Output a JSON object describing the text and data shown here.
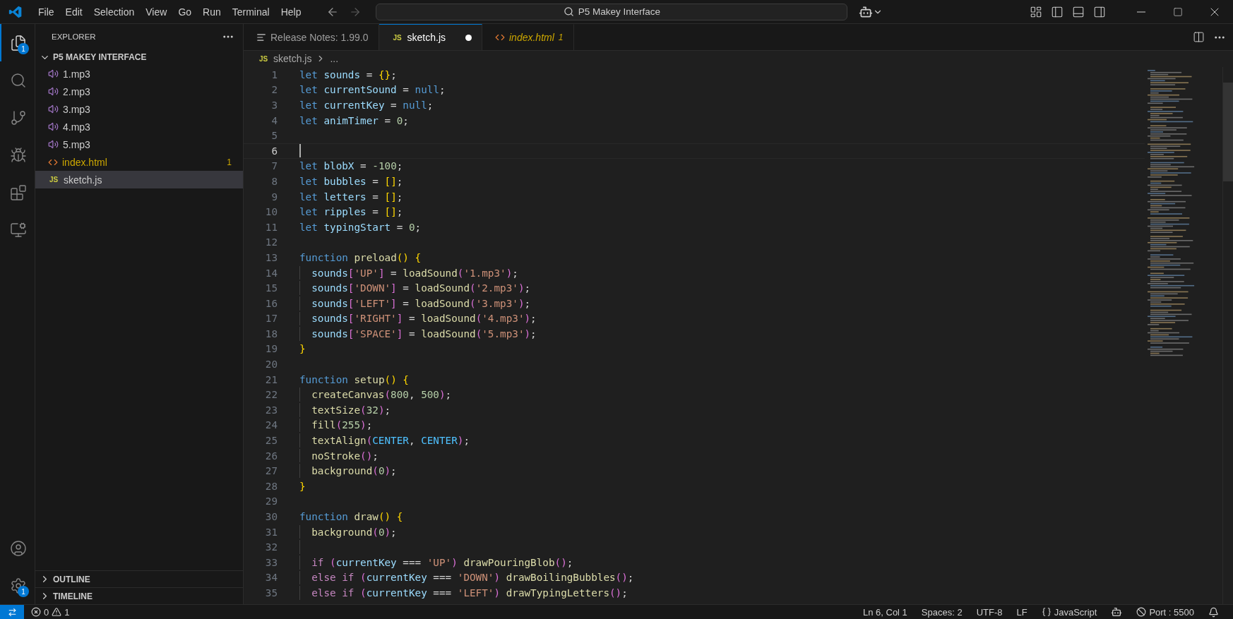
{
  "menu": [
    "File",
    "Edit",
    "Selection",
    "View",
    "Go",
    "Run",
    "Terminal",
    "Help"
  ],
  "command_center": "P5 Makey Interface",
  "activity_bar": {
    "top": [
      {
        "kind": "explorer",
        "selected": true,
        "badge": "1"
      },
      {
        "kind": "search",
        "selected": false
      },
      {
        "kind": "source-control",
        "selected": false
      },
      {
        "kind": "run-debug",
        "selected": false
      },
      {
        "kind": "extensions",
        "selected": false
      },
      {
        "kind": "remote",
        "selected": false
      }
    ],
    "bottom": [
      {
        "kind": "account",
        "selected": false
      },
      {
        "kind": "settings",
        "selected": false,
        "badge": "1"
      }
    ]
  },
  "sidebar": {
    "title": "EXPLORER",
    "folder": {
      "name": "P5 MAKEY INTERFACE",
      "expanded": true,
      "files": [
        {
          "name": "1.mp3",
          "kind": "audio",
          "selected": false
        },
        {
          "name": "2.mp3",
          "kind": "audio",
          "selected": false
        },
        {
          "name": "3.mp3",
          "kind": "audio",
          "selected": false
        },
        {
          "name": "4.mp3",
          "kind": "audio",
          "selected": false
        },
        {
          "name": "5.mp3",
          "kind": "audio",
          "selected": false
        },
        {
          "name": "index.html",
          "kind": "html",
          "selected": false,
          "problems": "1"
        },
        {
          "name": "sketch.js",
          "kind": "js",
          "icon_label": "JS",
          "selected": true
        }
      ]
    },
    "sections": [
      {
        "name": "OUTLINE",
        "expanded": false
      },
      {
        "name": "TIMELINE",
        "expanded": false
      }
    ]
  },
  "tabs": [
    {
      "label": "Release Notes: 1.99.0",
      "kind": "notes",
      "selected": false,
      "modified": false,
      "preview": false
    },
    {
      "label": "sketch.js",
      "kind": "js",
      "icon_label": "JS",
      "selected": true,
      "modified": true,
      "preview": false
    },
    {
      "label": "index.html",
      "kind": "html",
      "selected": false,
      "modified": false,
      "preview": true,
      "problems": "1"
    }
  ],
  "breadcrumb": {
    "icon_label": "JS",
    "file": "sketch.js",
    "rest": "..."
  },
  "code": [
    {
      "number": "1",
      "current": false,
      "indent": false,
      "tokens": [
        {
          "kind": "kw",
          "text": "let"
        },
        {
          "kind": "var",
          "text": " sounds"
        },
        {
          "kind": "op",
          "text": " = "
        },
        {
          "kind": "b1",
          "text": "{}"
        },
        {
          "kind": "op",
          "text": ";"
        }
      ]
    },
    {
      "number": "2",
      "current": false,
      "indent": false,
      "tokens": [
        {
          "kind": "kw",
          "text": "let"
        },
        {
          "kind": "var",
          "text": " currentSound"
        },
        {
          "kind": "op",
          "text": " = "
        },
        {
          "kind": "kw",
          "text": "null"
        },
        {
          "kind": "op",
          "text": ";"
        }
      ]
    },
    {
      "number": "3",
      "current": false,
      "indent": false,
      "tokens": [
        {
          "kind": "kw",
          "text": "let"
        },
        {
          "kind": "var",
          "text": " currentKey"
        },
        {
          "kind": "op",
          "text": " = "
        },
        {
          "kind": "kw",
          "text": "null"
        },
        {
          "kind": "op",
          "text": ";"
        }
      ]
    },
    {
      "number": "4",
      "current": false,
      "indent": false,
      "tokens": [
        {
          "kind": "kw",
          "text": "let"
        },
        {
          "kind": "var",
          "text": " animTimer"
        },
        {
          "kind": "op",
          "text": " = "
        },
        {
          "kind": "num",
          "text": "0"
        },
        {
          "kind": "op",
          "text": ";"
        }
      ]
    },
    {
      "number": "5",
      "current": false,
      "indent": false
    },
    {
      "number": "6",
      "current": true,
      "indent": false
    },
    {
      "number": "7",
      "current": false,
      "indent": false,
      "tokens": [
        {
          "kind": "kw",
          "text": "let"
        },
        {
          "kind": "var",
          "text": " blobX"
        },
        {
          "kind": "op",
          "text": " = "
        },
        {
          "kind": "num",
          "text": "-100"
        },
        {
          "kind": "op",
          "text": ";"
        }
      ]
    },
    {
      "number": "8",
      "current": false,
      "indent": false,
      "tokens": [
        {
          "kind": "kw",
          "text": "let"
        },
        {
          "kind": "var",
          "text": " bubbles"
        },
        {
          "kind": "op",
          "text": " = "
        },
        {
          "kind": "b1",
          "text": "[]"
        },
        {
          "kind": "op",
          "text": ";"
        }
      ]
    },
    {
      "number": "9",
      "current": false,
      "indent": false,
      "tokens": [
        {
          "kind": "kw",
          "text": "let"
        },
        {
          "kind": "var",
          "text": " letters"
        },
        {
          "kind": "op",
          "text": " = "
        },
        {
          "kind": "b1",
          "text": "[]"
        },
        {
          "kind": "op",
          "text": ";"
        }
      ]
    },
    {
      "number": "10",
      "current": false,
      "indent": false,
      "tokens": [
        {
          "kind": "kw",
          "text": "let"
        },
        {
          "kind": "var",
          "text": " ripples"
        },
        {
          "kind": "op",
          "text": " = "
        },
        {
          "kind": "b1",
          "text": "[]"
        },
        {
          "kind": "op",
          "text": ";"
        }
      ]
    },
    {
      "number": "11",
      "current": false,
      "indent": false,
      "tokens": [
        {
          "kind": "kw",
          "text": "let"
        },
        {
          "kind": "var",
          "text": " typingStart"
        },
        {
          "kind": "op",
          "text": " = "
        },
        {
          "kind": "num",
          "text": "0"
        },
        {
          "kind": "op",
          "text": ";"
        }
      ]
    },
    {
      "number": "12",
      "current": false,
      "indent": false
    },
    {
      "number": "13",
      "current": false,
      "indent": false,
      "tokens": [
        {
          "kind": "kw",
          "text": "function"
        },
        {
          "kind": "fn",
          "text": " preload"
        },
        {
          "kind": "b1",
          "text": "()"
        },
        {
          "kind": "b1",
          "text": " {"
        }
      ]
    },
    {
      "number": "14",
      "current": false,
      "indent": true,
      "tokens": [
        {
          "kind": "var",
          "text": "sounds"
        },
        {
          "kind": "b2",
          "text": "["
        },
        {
          "kind": "str",
          "text": "'UP'"
        },
        {
          "kind": "b2",
          "text": "]"
        },
        {
          "kind": "op",
          "text": " = "
        },
        {
          "kind": "fn",
          "text": "loadSound"
        },
        {
          "kind": "b2",
          "text": "("
        },
        {
          "kind": "str",
          "text": "'1.mp3'"
        },
        {
          "kind": "b2",
          "text": ")"
        },
        {
          "kind": "op",
          "text": ";"
        }
      ]
    },
    {
      "number": "15",
      "current": false,
      "indent": true,
      "tokens": [
        {
          "kind": "var",
          "text": "sounds"
        },
        {
          "kind": "b2",
          "text": "["
        },
        {
          "kind": "str",
          "text": "'DOWN'"
        },
        {
          "kind": "b2",
          "text": "]"
        },
        {
          "kind": "op",
          "text": " = "
        },
        {
          "kind": "fn",
          "text": "loadSound"
        },
        {
          "kind": "b2",
          "text": "("
        },
        {
          "kind": "str",
          "text": "'2.mp3'"
        },
        {
          "kind": "b2",
          "text": ")"
        },
        {
          "kind": "op",
          "text": ";"
        }
      ]
    },
    {
      "number": "16",
      "current": false,
      "indent": true,
      "tokens": [
        {
          "kind": "var",
          "text": "sounds"
        },
        {
          "kind": "b2",
          "text": "["
        },
        {
          "kind": "str",
          "text": "'LEFT'"
        },
        {
          "kind": "b2",
          "text": "]"
        },
        {
          "kind": "op",
          "text": " = "
        },
        {
          "kind": "fn",
          "text": "loadSound"
        },
        {
          "kind": "b2",
          "text": "("
        },
        {
          "kind": "str",
          "text": "'3.mp3'"
        },
        {
          "kind": "b2",
          "text": ")"
        },
        {
          "kind": "op",
          "text": ";"
        }
      ]
    },
    {
      "number": "17",
      "current": false,
      "indent": true,
      "tokens": [
        {
          "kind": "var",
          "text": "sounds"
        },
        {
          "kind": "b2",
          "text": "["
        },
        {
          "kind": "str",
          "text": "'RIGHT'"
        },
        {
          "kind": "b2",
          "text": "]"
        },
        {
          "kind": "op",
          "text": " = "
        },
        {
          "kind": "fn",
          "text": "loadSound"
        },
        {
          "kind": "b2",
          "text": "("
        },
        {
          "kind": "str",
          "text": "'4.mp3'"
        },
        {
          "kind": "b2",
          "text": ")"
        },
        {
          "kind": "op",
          "text": ";"
        }
      ]
    },
    {
      "number": "18",
      "current": false,
      "indent": true,
      "tokens": [
        {
          "kind": "var",
          "text": "sounds"
        },
        {
          "kind": "b2",
          "text": "["
        },
        {
          "kind": "str",
          "text": "'SPACE'"
        },
        {
          "kind": "b2",
          "text": "]"
        },
        {
          "kind": "op",
          "text": " = "
        },
        {
          "kind": "fn",
          "text": "loadSound"
        },
        {
          "kind": "b2",
          "text": "("
        },
        {
          "kind": "str",
          "text": "'5.mp3'"
        },
        {
          "kind": "b2",
          "text": ")"
        },
        {
          "kind": "op",
          "text": ";"
        }
      ]
    },
    {
      "number": "19",
      "current": false,
      "indent": false,
      "tokens": [
        {
          "kind": "b1",
          "text": "}"
        }
      ]
    },
    {
      "number": "20",
      "current": false,
      "indent": false
    },
    {
      "number": "21",
      "current": false,
      "indent": false,
      "tokens": [
        {
          "kind": "kw",
          "text": "function"
        },
        {
          "kind": "fn",
          "text": " setup"
        },
        {
          "kind": "b1",
          "text": "()"
        },
        {
          "kind": "b1",
          "text": " {"
        }
      ]
    },
    {
      "number": "22",
      "current": false,
      "indent": true,
      "tokens": [
        {
          "kind": "fn",
          "text": "createCanvas"
        },
        {
          "kind": "b2",
          "text": "("
        },
        {
          "kind": "num",
          "text": "800"
        },
        {
          "kind": "op",
          "text": ","
        },
        {
          "kind": "num",
          "text": " 500"
        },
        {
          "kind": "b2",
          "text": ")"
        },
        {
          "kind": "op",
          "text": ";"
        }
      ]
    },
    {
      "number": "23",
      "current": false,
      "indent": true,
      "tokens": [
        {
          "kind": "fn",
          "text": "textSize"
        },
        {
          "kind": "b2",
          "text": "("
        },
        {
          "kind": "num",
          "text": "32"
        },
        {
          "kind": "b2",
          "text": ")"
        },
        {
          "kind": "op",
          "text": ";"
        }
      ]
    },
    {
      "number": "24",
      "current": false,
      "indent": true,
      "tokens": [
        {
          "kind": "fn",
          "text": "fill"
        },
        {
          "kind": "b2",
          "text": "("
        },
        {
          "kind": "num",
          "text": "255"
        },
        {
          "kind": "b2",
          "text": ")"
        },
        {
          "kind": "op",
          "text": ";"
        }
      ]
    },
    {
      "number": "25",
      "current": false,
      "indent": true,
      "tokens": [
        {
          "kind": "fn",
          "text": "textAlign"
        },
        {
          "kind": "b2",
          "text": "("
        },
        {
          "kind": "const",
          "text": "CENTER"
        },
        {
          "kind": "op",
          "text": ","
        },
        {
          "kind": "const",
          "text": " CENTER"
        },
        {
          "kind": "b2",
          "text": ")"
        },
        {
          "kind": "op",
          "text": ";"
        }
      ]
    },
    {
      "number": "26",
      "current": false,
      "indent": true,
      "tokens": [
        {
          "kind": "fn",
          "text": "noStroke"
        },
        {
          "kind": "b2",
          "text": "()"
        },
        {
          "kind": "op",
          "text": ";"
        }
      ]
    },
    {
      "number": "27",
      "current": false,
      "indent": true,
      "tokens": [
        {
          "kind": "fn",
          "text": "background"
        },
        {
          "kind": "b2",
          "text": "("
        },
        {
          "kind": "num",
          "text": "0"
        },
        {
          "kind": "b2",
          "text": ")"
        },
        {
          "kind": "op",
          "text": ";"
        }
      ]
    },
    {
      "number": "28",
      "current": false,
      "indent": false,
      "tokens": [
        {
          "kind": "b1",
          "text": "}"
        }
      ]
    },
    {
      "number": "29",
      "current": false,
      "indent": false
    },
    {
      "number": "30",
      "current": false,
      "indent": false,
      "tokens": [
        {
          "kind": "kw",
          "text": "function"
        },
        {
          "kind": "fn",
          "text": " draw"
        },
        {
          "kind": "b1",
          "text": "()"
        },
        {
          "kind": "b1",
          "text": " {"
        }
      ]
    },
    {
      "number": "31",
      "current": false,
      "indent": true,
      "tokens": [
        {
          "kind": "fn",
          "text": "background"
        },
        {
          "kind": "b2",
          "text": "("
        },
        {
          "kind": "num",
          "text": "0"
        },
        {
          "kind": "b2",
          "text": ")"
        },
        {
          "kind": "op",
          "text": ";"
        }
      ]
    },
    {
      "number": "32",
      "current": false,
      "indent": true
    },
    {
      "number": "33",
      "current": false,
      "indent": true,
      "tokens": [
        {
          "kind": "ctl",
          "text": "if"
        },
        {
          "kind": "b2",
          "text": " ("
        },
        {
          "kind": "var",
          "text": "currentKey"
        },
        {
          "kind": "op",
          "text": " === "
        },
        {
          "kind": "str",
          "text": "'UP'"
        },
        {
          "kind": "b2",
          "text": ")"
        },
        {
          "kind": "fn",
          "text": " drawPouringBlob"
        },
        {
          "kind": "b2",
          "text": "()"
        },
        {
          "kind": "op",
          "text": ";"
        }
      ]
    },
    {
      "number": "34",
      "current": false,
      "indent": true,
      "tokens": [
        {
          "kind": "ctl",
          "text": "else"
        },
        {
          "kind": "ctl",
          "text": " if"
        },
        {
          "kind": "b2",
          "text": " ("
        },
        {
          "kind": "var",
          "text": "currentKey"
        },
        {
          "kind": "op",
          "text": " === "
        },
        {
          "kind": "str",
          "text": "'DOWN'"
        },
        {
          "kind": "b2",
          "text": ")"
        },
        {
          "kind": "fn",
          "text": " drawBoilingBubbles"
        },
        {
          "kind": "b2",
          "text": "()"
        },
        {
          "kind": "op",
          "text": ";"
        }
      ]
    },
    {
      "number": "35",
      "current": false,
      "indent": true,
      "tokens": [
        {
          "kind": "ctl",
          "text": "else"
        },
        {
          "kind": "ctl",
          "text": " if"
        },
        {
          "kind": "b2",
          "text": " ("
        },
        {
          "kind": "var",
          "text": "currentKey"
        },
        {
          "kind": "op",
          "text": " === "
        },
        {
          "kind": "str",
          "text": "'LEFT'"
        },
        {
          "kind": "b2",
          "text": ")"
        },
        {
          "kind": "fn",
          "text": " drawTypingLetters"
        },
        {
          "kind": "b2",
          "text": "()"
        },
        {
          "kind": "op",
          "text": ";"
        }
      ]
    }
  ],
  "status_bar": {
    "errors": "0",
    "warnings": "1",
    "right": [
      {
        "kind": "text",
        "text": "Ln 6, Col 1"
      },
      {
        "kind": "text",
        "text": "Spaces: 2"
      },
      {
        "kind": "text",
        "text": "UTF-8"
      },
      {
        "kind": "text",
        "text": "LF"
      },
      {
        "kind": "language",
        "text": "JavaScript"
      },
      {
        "kind": "copilot"
      },
      {
        "kind": "port",
        "text": "Port : 5500"
      },
      {
        "kind": "bell"
      }
    ]
  }
}
